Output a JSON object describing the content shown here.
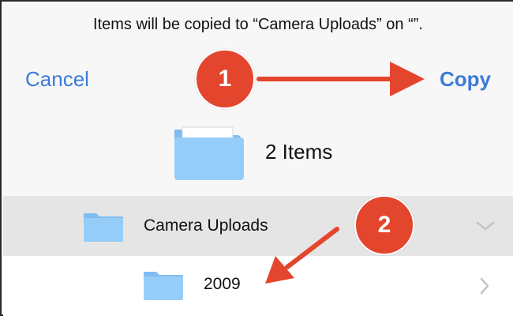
{
  "header": {
    "message": "Items will be copied to “Camera Uploads” on “”.",
    "cancel_label": "Cancel",
    "copy_label": "Copy",
    "items_count": "2 Items"
  },
  "annotations": {
    "step1": "1",
    "step2": "2",
    "badge_color": "#e4452d"
  },
  "list": {
    "rows": [
      {
        "label": "Camera Uploads",
        "icon": "folder-icon",
        "chevron": "chevron-down-icon",
        "selected": true
      },
      {
        "label": "2009",
        "icon": "folder-icon",
        "chevron": "chevron-right-icon",
        "selected": false
      }
    ]
  },
  "colors": {
    "accent": "#3b7bd7",
    "folder": "#8ec8f6",
    "selected_row": "#e5e5e5"
  }
}
